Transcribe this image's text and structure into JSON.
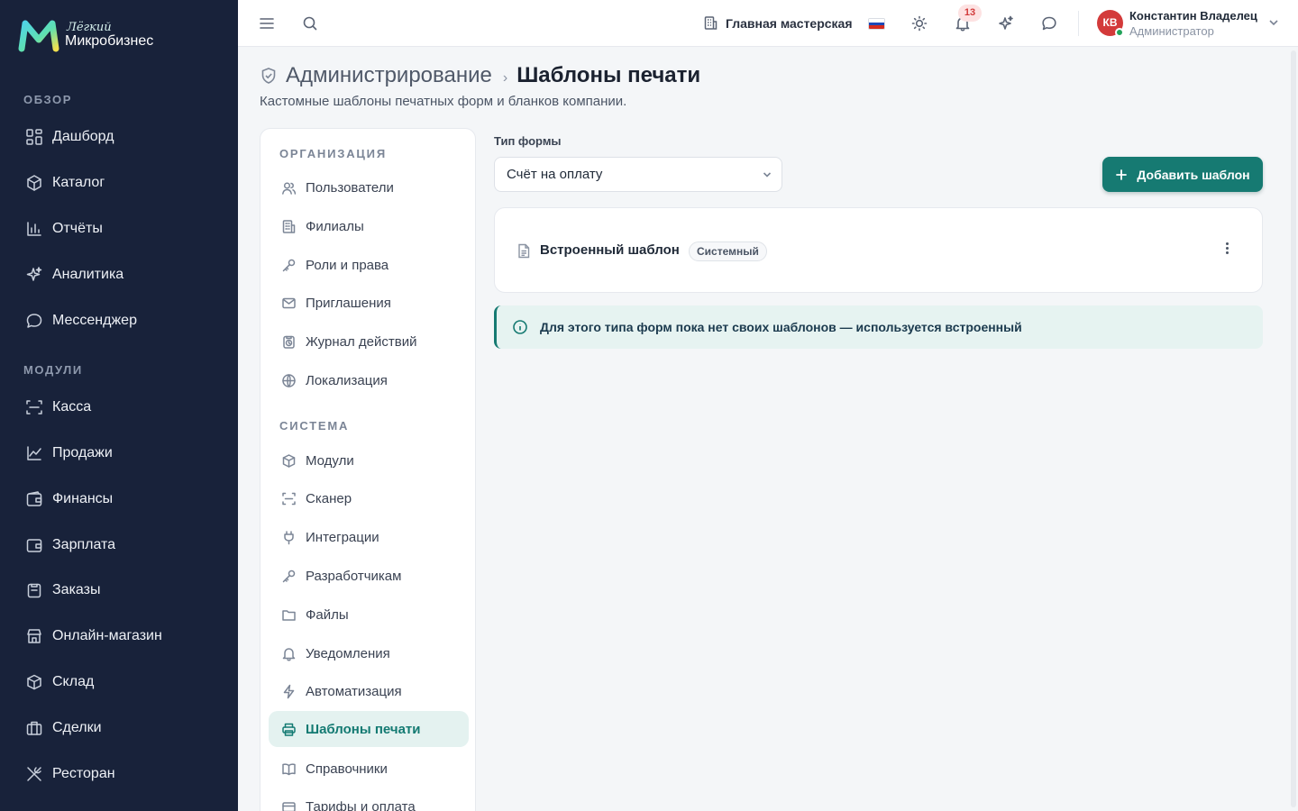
{
  "brand": {
    "tagline": "Лёгкий",
    "name": "Микробизнес"
  },
  "sidebar": {
    "sections": [
      {
        "label": "ОБЗОР",
        "items": [
          {
            "label": "Дашборд",
            "icon": "grid-icon"
          },
          {
            "label": "Каталог",
            "icon": "box-tag-icon"
          },
          {
            "label": "Отчёты",
            "icon": "bar-chart-icon"
          },
          {
            "label": "Аналитика",
            "icon": "sparkles-icon"
          },
          {
            "label": "Мессенджер",
            "icon": "chat-icon"
          }
        ]
      },
      {
        "label": "МОДУЛИ",
        "items": [
          {
            "label": "Касса",
            "icon": "scan-icon"
          },
          {
            "label": "Продажи",
            "icon": "line-chart-icon"
          },
          {
            "label": "Финансы",
            "icon": "wallet-icon"
          },
          {
            "label": "Зарплата",
            "icon": "wallet-icon"
          },
          {
            "label": "Заказы",
            "icon": "clipboard-icon"
          },
          {
            "label": "Онлайн-магазин",
            "icon": "store-icon"
          },
          {
            "label": "Склад",
            "icon": "package-icon"
          },
          {
            "label": "Сделки",
            "icon": "briefcase-icon"
          },
          {
            "label": "Ресторан",
            "icon": "utensils-icon"
          }
        ]
      }
    ]
  },
  "topbar": {
    "workshop": "Главная мастерская",
    "notifications_count": "13",
    "user": {
      "initials": "КВ",
      "name": "Константин Владелец",
      "role": "Администратор"
    }
  },
  "page": {
    "breadcrumb_parent": "Администрирование",
    "breadcrumb_separator": "›",
    "title": "Шаблоны печати",
    "subtitle": "Кастомные шаблоны печатных форм и бланков компании."
  },
  "settings_nav": {
    "sections": [
      {
        "label": "ОРГАНИЗАЦИЯ",
        "items": [
          {
            "label": "Пользователи",
            "icon": "users-icon"
          },
          {
            "label": "Филиалы",
            "icon": "building-icon"
          },
          {
            "label": "Роли и права",
            "icon": "key-icon"
          },
          {
            "label": "Приглашения",
            "icon": "mail-icon"
          },
          {
            "label": "Журнал действий",
            "icon": "history-icon"
          },
          {
            "label": "Локализация",
            "icon": "globe-icon"
          }
        ]
      },
      {
        "label": "СИСТЕМА",
        "items": [
          {
            "label": "Модули",
            "icon": "cube-icon"
          },
          {
            "label": "Сканер",
            "icon": "scan-icon"
          },
          {
            "label": "Интеграции",
            "icon": "plug-icon"
          },
          {
            "label": "Разработчикам",
            "icon": "key-icon"
          },
          {
            "label": "Файлы",
            "icon": "folder-icon"
          },
          {
            "label": "Уведомления",
            "icon": "bell-icon"
          },
          {
            "label": "Автоматизация",
            "icon": "bolt-icon"
          },
          {
            "label": "Шаблоны печати",
            "icon": "printer-icon",
            "active": true
          },
          {
            "label": "Справочники",
            "icon": "book-icon"
          },
          {
            "label": "Тарифы и оплата",
            "icon": "card-icon"
          }
        ]
      }
    ]
  },
  "main": {
    "form_type_label": "Тип формы",
    "form_type_value": "Счёт на оплату",
    "add_button": "Добавить шаблон",
    "template": {
      "title": "Встроенный шаблон",
      "badge": "Системный"
    },
    "info": "Для этого типа форм пока нет своих шаблонов — используется встроенный"
  },
  "colors": {
    "accent": "#167a72",
    "sidebar_bg": "#18223a",
    "active_bg": "#e4f2f0",
    "badge_bg": "#fde2e2"
  }
}
